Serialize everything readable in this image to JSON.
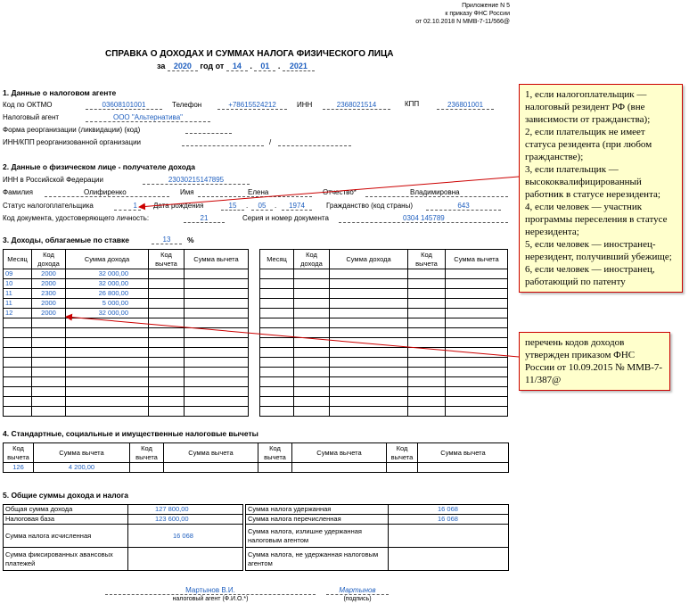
{
  "header": {
    "appendix": "Приложение N 5",
    "order": "к приказу ФНС России",
    "order_date": "от 02.10.2018 N ММВ-7-11/566@"
  },
  "title": {
    "main": "СПРАВКА О ДОХОДАХ И СУММАХ НАЛОГА ФИЗИЧЕСКОГО ЛИЦА",
    "for_label": "за",
    "year": "2020",
    "year_label": "год",
    "from_label": "от",
    "day": "14",
    "month": "01",
    "doc_year": "2021"
  },
  "agent": {
    "section_title": "1. Данные о налоговом агенте",
    "oktmo_label": "Код по ОКТМО",
    "oktmo": "03608101001",
    "phone_label": "Телефон",
    "phone": "+78615524212",
    "inn_label": "ИНН",
    "inn": "2368021514",
    "kpp_label": "КПП",
    "kpp": "236801001",
    "name_label": "Налоговый агент",
    "name": "ООО \"Альтернатива\"",
    "reorg_label": "Форма реорганизации (ликвидации) (код)",
    "reorg_inn_label": "ИНН/КПП реорганизованной организации",
    "slash": "/"
  },
  "person": {
    "section_title": "2. Данные о физическом лице - получателе дохода",
    "inn_label": "ИНН в Российской Федерации",
    "inn": "230302151478​95",
    "surname_label": "Фамилия",
    "surname": "Олифиренко",
    "name_label": "Имя",
    "name": "Елена",
    "patronymic_label": "Отчество*",
    "patronymic": "Владимировна",
    "status_label": "Статус налогоплательщика",
    "status": "1",
    "birth_label": "Дата рождения",
    "birth_day": "15",
    "birth_month": "05",
    "birth_year": "1974",
    "citizenship_label": "Гражданство (код страны)",
    "citizenship": "643",
    "doc_code_label": "Код документа, удостоверяющего личность:",
    "doc_code": "21",
    "doc_number_label": "Серия и номер документа",
    "doc_number": "0304 145789"
  },
  "income": {
    "section_title": "3. Доходы, облагаемые по ставке",
    "rate": "13",
    "percent": "%",
    "headers": [
      "Месяц",
      "Код дохода",
      "Сумма дохода",
      "Код вычета",
      "Сумма вычета"
    ],
    "rows": [
      {
        "month": "09",
        "code": "2000",
        "amount": "32 000,00"
      },
      {
        "month": "10",
        "code": "2000",
        "amount": "32 000,00"
      },
      {
        "month": "11",
        "code": "2300",
        "amount": "26 800,00"
      },
      {
        "month": "11",
        "code": "2000",
        "amount": "5 000,00"
      },
      {
        "month": "12",
        "code": "2000",
        "amount": "32 000,00"
      }
    ]
  },
  "deductions": {
    "section_title": "4. Стандартные, социальные и имущественные налоговые вычеты",
    "code_header": "Код вычета",
    "sum_header": "Сумма вычета",
    "code": "126",
    "sum": "4 200,00"
  },
  "totals": {
    "section_title": "5. Общие суммы дохода и налога",
    "total_income_label": "Общая сумма дохода",
    "total_income": "127 800,00",
    "tax_base_label": "Налоговая база",
    "tax_base": "123 600,00",
    "tax_calc_label": "Сумма налога исчисленная",
    "tax_calc": "16 068",
    "fixed_adv_label": "Сумма фиксированных авансовых платежей",
    "withheld_label": "Сумма налога удержанная",
    "withheld": "16 068",
    "transferred_label": "Сумма налога перечисленная",
    "transferred": "16 068",
    "excess_label": "Сумма налога, излишне удержанная налоговым агентом",
    "not_withheld_label": "Сумма налога, не удержанная налоговым агентом"
  },
  "signature": {
    "agent_name": "Мартынов В.И.",
    "agent_caption": "налоговый агент (Ф.И.О.*)",
    "sign": "Мартынов",
    "sign_caption": "(подпись)"
  },
  "callouts": {
    "status_codes": [
      "1, если налогоплательщик — налоговый резидент РФ (вне зависимости от гражданства);",
      "2, если плательщик не имеет статуса резидента (при любом гражданстве);",
      "3, если плательщик — высококвалифицированный работник в статусе нерезидента;",
      "4, если человек — участник программы переселения в статусе нерезидента;",
      "5, если человек — иностранец-нерезидент, получивший убежище;",
      "6, если человек — иностранец, работающий по патенту"
    ],
    "income_codes": "перечень кодов доходов утвержден приказом ФНС России от 10.09.2015 № ММВ-7-11/387@"
  },
  "colors": {
    "value": "#1f5fbf",
    "callout_bg": "#ffffcc",
    "callout_border": "#cc0000",
    "arrow": "#cc0000"
  }
}
